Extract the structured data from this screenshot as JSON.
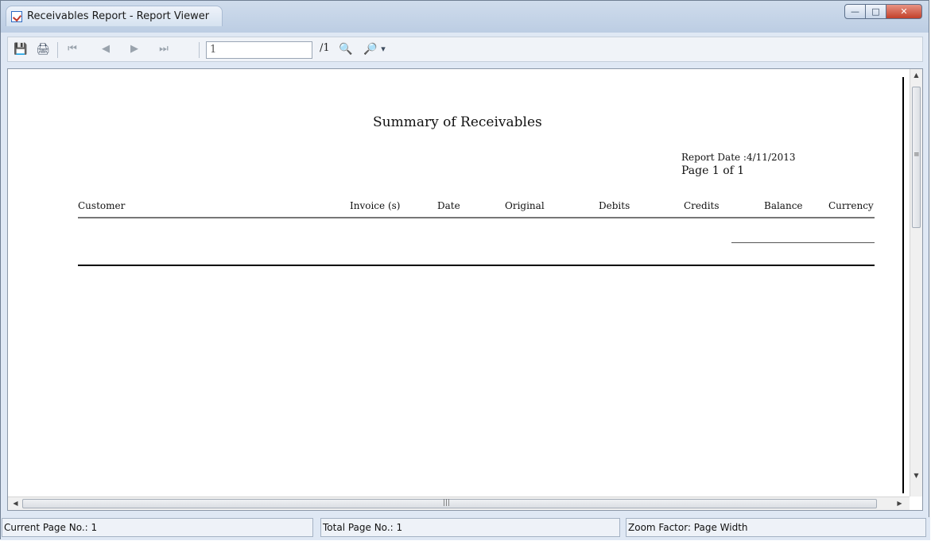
{
  "window": {
    "title": "Receivables Report - Report Viewer",
    "minimize_glyph": "—",
    "maximize_glyph": "□",
    "close_glyph": "✕"
  },
  "toolbar": {
    "current_page": "1",
    "total_pages": "/1",
    "first_glyph": "⏮",
    "prev_glyph": "◀",
    "next_glyph": "▶",
    "last_glyph": "⏭",
    "export_glyph": "💾",
    "print_glyph": "🖨",
    "find_glyph": "🔍",
    "zoom_glyph": "🔎",
    "dropdown_glyph": "▾"
  },
  "report": {
    "title": "Summary of Receivables",
    "report_date": "Report Date :4/11/2013",
    "page_label": "Page 1 of 1",
    "columns": [
      "Customer",
      "Invoice (s)",
      "Date",
      "Original",
      "Debits",
      "Credits",
      "Balance",
      "Currency"
    ]
  },
  "scrollbar": {
    "up": "▲",
    "down": "▼",
    "left": "◀",
    "right": "▶",
    "grip_v": "≡",
    "grip_h": "|||"
  },
  "status": {
    "current_page": "Current Page No.: 1",
    "total_pages": "Total Page No.: 1",
    "zoom": "Zoom Factor: Page Width"
  },
  "colors": {
    "title_bar": "#c5d4e8",
    "close_button": "#c3402a",
    "page_border": "#000000"
  }
}
